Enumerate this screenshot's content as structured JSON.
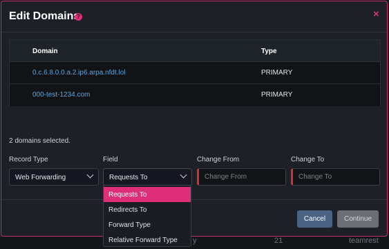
{
  "background": {
    "row": [
      "y",
      "21",
      "teamrest"
    ]
  },
  "modal": {
    "title": "Edit Domains",
    "help_icon": "?",
    "close_icon": "×"
  },
  "table": {
    "headers": {
      "domain": "Domain",
      "type": "Type"
    },
    "rows": [
      {
        "domain": "0.c.6.8.0.0.a.2.ip6.arpa.nfdt.lol",
        "type": "PRIMARY"
      },
      {
        "domain": "000-test-1234.com",
        "type": "PRIMARY"
      }
    ]
  },
  "selection": {
    "text": "2 domains selected."
  },
  "form": {
    "record_type": {
      "label": "Record Type",
      "value": "Web Forwarding"
    },
    "field": {
      "label": "Field",
      "value": "Requests To",
      "options": [
        "Requests To",
        "Redirects To",
        "Forward Type",
        "Relative Forward Type"
      ],
      "selected_option": "Requests To"
    },
    "change_from": {
      "label": "Change From",
      "placeholder": "Change From"
    },
    "change_to": {
      "label": "Change To",
      "placeholder": "Change To"
    }
  },
  "buttons": {
    "cancel": "Cancel",
    "continue": "Continue"
  },
  "colors": {
    "accent": "#e0307b",
    "error_bar": "#d93038",
    "link": "#5da6e0",
    "cancel_bg": "#4a6283",
    "continue_bg": "#6b6f75"
  }
}
